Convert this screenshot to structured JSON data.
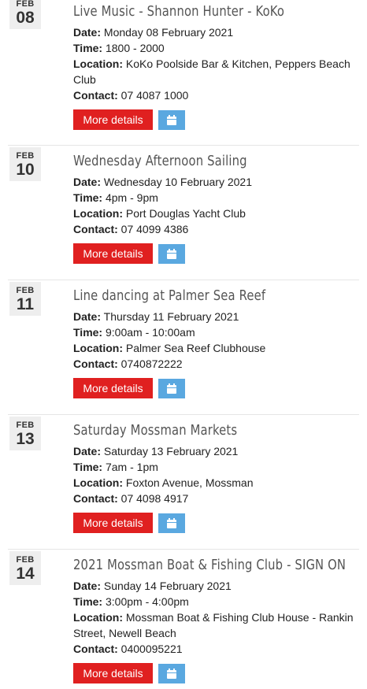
{
  "labels": {
    "date": "Date:",
    "time": "Time:",
    "location": "Location:",
    "contact": "Contact:"
  },
  "events": [
    {
      "month": "FEB",
      "day": "08",
      "title": "Live Music - Shannon Hunter - KoKo",
      "date": "Monday 08 February 2021",
      "time": "1800 - 2000",
      "location": "KoKo Poolside Bar & Kitchen, Peppers Beach Club",
      "contact": "07 4087 1000",
      "more_label": "More details",
      "calendar_icon": "calendar-icon"
    },
    {
      "month": "FEB",
      "day": "10",
      "title": "Wednesday Afternoon Sailing",
      "date": "Wednesday 10 February 2021",
      "time": "4pm - 9pm",
      "location": "Port Douglas Yacht Club",
      "contact": "07 4099 4386",
      "more_label": "More details",
      "calendar_icon": "calendar-icon"
    },
    {
      "month": "FEB",
      "day": "11",
      "title": "Line dancing at Palmer Sea Reef",
      "date": "Thursday 11 February 2021",
      "time": "9:00am - 10:00am",
      "location": "Palmer Sea Reef Clubhouse",
      "contact": "0740872222",
      "more_label": "More details",
      "calendar_icon": "calendar-icon"
    },
    {
      "month": "FEB",
      "day": "13",
      "title": "Saturday Mossman Markets",
      "date": "Saturday 13 February 2021",
      "time": "7am - 1pm",
      "location": "Foxton Avenue, Mossman",
      "contact": "07 4098 4917",
      "more_label": "More details",
      "calendar_icon": "calendar-icon"
    },
    {
      "month": "FEB",
      "day": "14",
      "title": "2021 Mossman Boat & Fishing Club - SIGN ON",
      "date": "Sunday 14 February 2021",
      "time": "3:00pm - 4:00pm",
      "location": "Mossman Boat & Fishing Club House - Rankin Street, Newell Beach",
      "contact": "0400095221",
      "more_label": "More details",
      "calendar_icon": "calendar-icon"
    }
  ],
  "colors": {
    "more_button": "#e02020",
    "calendar_button": "#5aa8e0",
    "date_box": "#eeeeee"
  }
}
